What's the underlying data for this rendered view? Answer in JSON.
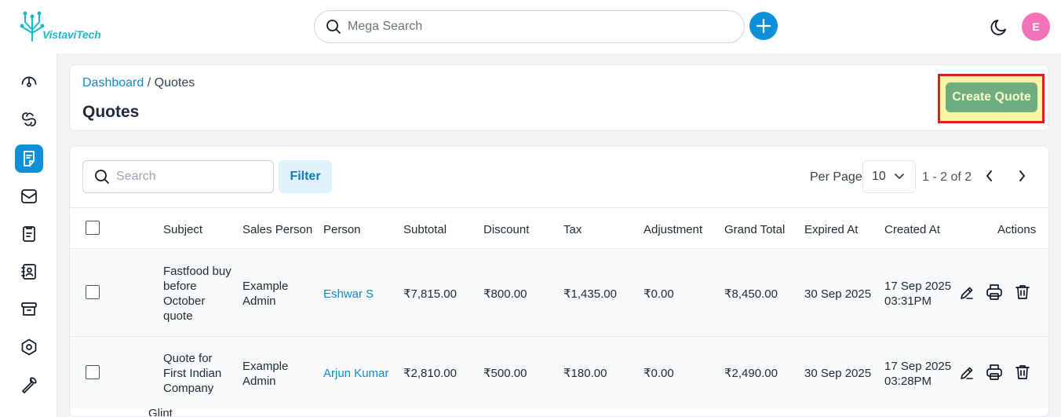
{
  "header": {
    "logo_text": "VistaviTech",
    "search_placeholder": "Mega Search",
    "avatar_initial": "E"
  },
  "sidebar": {
    "items": [
      {
        "icon": "dashboard-icon",
        "active": false
      },
      {
        "icon": "leads-icon",
        "active": false
      },
      {
        "icon": "quotes-icon",
        "active": true
      },
      {
        "icon": "mail-icon",
        "active": false
      },
      {
        "icon": "activities-icon",
        "active": false
      },
      {
        "icon": "contacts-icon",
        "active": false
      },
      {
        "icon": "products-icon",
        "active": false
      },
      {
        "icon": "settings-icon",
        "active": false
      },
      {
        "icon": "configuration-icon",
        "active": false
      }
    ]
  },
  "page": {
    "breadcrumb_parent": "Dashboard",
    "breadcrumb_sep": " / ",
    "breadcrumb_current": "Quotes",
    "title": "Quotes",
    "create_label": "Create Quote"
  },
  "toolbar": {
    "search_placeholder": "Search",
    "filter_label": "Filter",
    "per_page_label": "Per Page",
    "per_page_value": "10",
    "range_text": "1 - 2 of 2"
  },
  "table": {
    "columns": [
      "Subject",
      "Sales Person",
      "Person",
      "Subtotal",
      "Discount",
      "Tax",
      "Adjustment",
      "Grand Total",
      "Expired At",
      "Created At",
      "Actions"
    ],
    "rows": [
      {
        "subject": [
          "Fastfood buy",
          "before",
          "October",
          "quote"
        ],
        "sales_person": [
          "Example",
          "Admin"
        ],
        "person": "Eshwar S",
        "subtotal": "₹7,815.00",
        "discount": "₹800.00",
        "tax": "₹1,435.00",
        "adjustment": "₹0.00",
        "grand_total": "₹8,450.00",
        "expired_at": "30 Sep 2025",
        "created_at": [
          "17 Sep 2025",
          "03:31PM"
        ]
      },
      {
        "subject": [
          "Quote for",
          "First Indian",
          "Company"
        ],
        "sales_person": [
          "Example",
          "Admin"
        ],
        "person": "Arjun Kumar",
        "subtotal": "₹2,810.00",
        "discount": "₹500.00",
        "tax": "₹180.00",
        "adjustment": "₹0.00",
        "grand_total": "₹2,490.00",
        "expired_at": "30 Sep 2025",
        "created_at": [
          "17 Sep 2025",
          "03:28PM"
        ]
      }
    ],
    "cutoff_text": "Glint"
  },
  "colors": {
    "accent": "#0e90d9",
    "create_button": "#6dad7f",
    "highlight_border": "#e11d1d",
    "highlight_fill": "#fbf6a6",
    "avatar": "#f472b6"
  }
}
